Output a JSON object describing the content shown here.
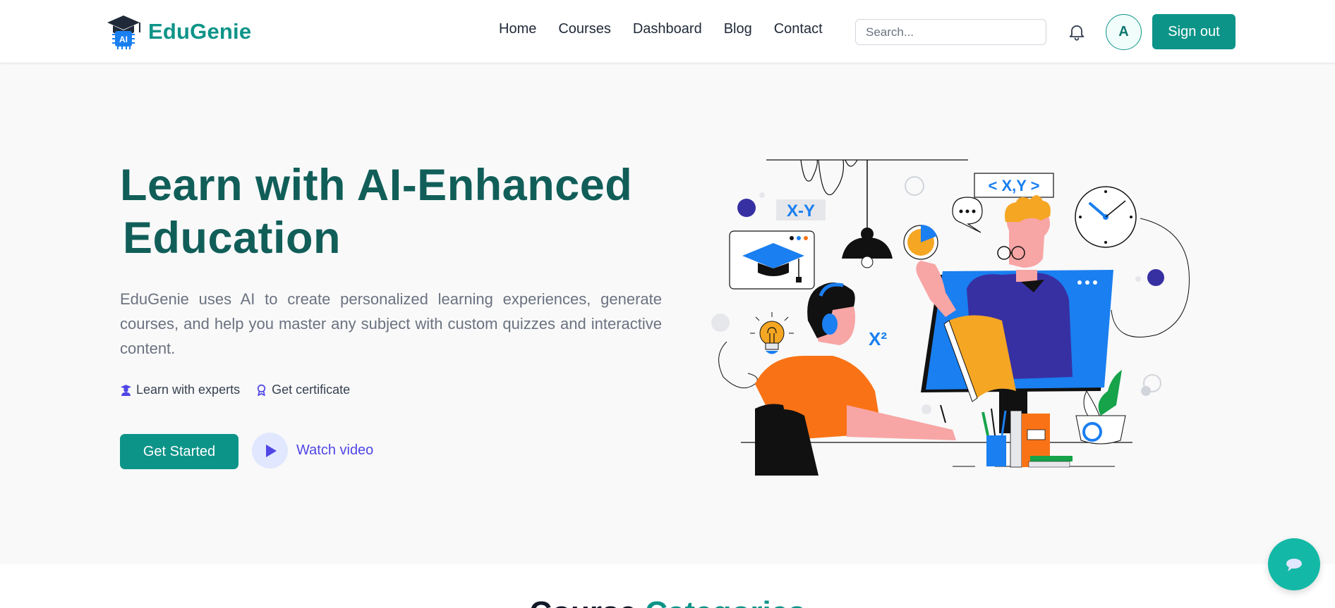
{
  "brand": {
    "name": "EduGenie",
    "logo_badge": "AI"
  },
  "nav": {
    "links": [
      "Home",
      "Courses",
      "Dashboard",
      "Blog",
      "Contact"
    ],
    "search_placeholder": "Search...",
    "avatar_initial": "A",
    "signout_label": "Sign out"
  },
  "hero": {
    "title_line1": "Learn with AI-Enhanced",
    "title_line2": "Education",
    "description": "EduGenie uses AI to create personalized learning experiences, generate courses, and help you master any subject with custom quizzes and interactive content.",
    "features": [
      "Learn with experts",
      "Get certificate"
    ],
    "cta_label": "Get Started",
    "watch_label": "Watch video"
  },
  "illustration": {
    "formula_xy": "X-Y",
    "formula_code": "< X,Y >",
    "formula_sq": "X²"
  },
  "next_section": {
    "heading_part1": "Course",
    "heading_part2": "Categories"
  },
  "colors": {
    "primary": "#0d9488",
    "title": "#115e59",
    "accent_indigo": "#4f46e5",
    "illustration_blue": "#1a7ff0",
    "illustration_orange": "#f5a623"
  }
}
